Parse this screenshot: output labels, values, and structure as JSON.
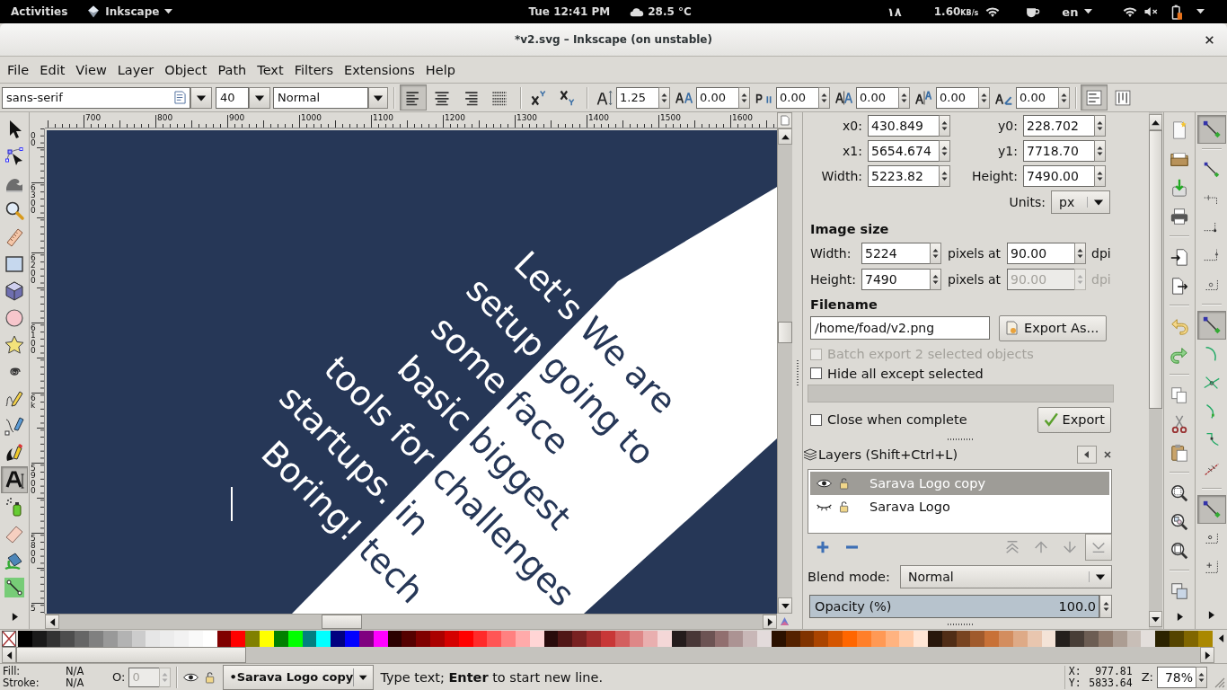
{
  "top_bar": {
    "activities": "Activities",
    "app_menu": "Inkscape",
    "clock": "Tue 12:41 PM",
    "weather": "28.5 °C",
    "indicator": "۱۸",
    "net_speed": "1.60",
    "net_unit": "KB/s",
    "language": "en"
  },
  "window": {
    "title": "*v2.svg – Inkscape (on unstable)"
  },
  "menu": [
    "File",
    "Edit",
    "View",
    "Layer",
    "Object",
    "Path",
    "Text",
    "Filters",
    "Extensions",
    "Help"
  ],
  "text_toolbar": {
    "font_family": "sans-serif",
    "font_size": "40",
    "font_style": "Normal",
    "align_buttons": [
      {
        "kind": "left",
        "selected": true
      },
      {
        "kind": "center",
        "selected": false
      },
      {
        "kind": "right",
        "selected": false
      },
      {
        "kind": "justify",
        "selected": false
      }
    ],
    "script_buttons": [
      {
        "kind": "superscript",
        "selected": false
      },
      {
        "kind": "subscript",
        "selected": false
      }
    ],
    "spacing_fields": [
      {
        "kind": "line",
        "value": "1.25"
      },
      {
        "kind": "letter",
        "value": "0.00"
      },
      {
        "kind": "word",
        "value": "0.00"
      },
      {
        "kind": "kern",
        "value": "0.00"
      },
      {
        "kind": "shift",
        "value": "0.00"
      },
      {
        "kind": "rotate",
        "value": "0.00"
      }
    ],
    "orientation_buttons": [
      {
        "kind": "horizontal",
        "selected": true
      },
      {
        "kind": "vertical",
        "selected": false
      }
    ]
  },
  "toolbox": [
    {
      "kind": "select",
      "selected": false
    },
    {
      "kind": "node",
      "selected": false
    },
    {
      "kind": "tweak",
      "selected": false
    },
    {
      "kind": "zoom",
      "selected": false
    },
    {
      "kind": "measure",
      "selected": false
    },
    {
      "kind": "rect",
      "selected": false
    },
    {
      "kind": "box3d",
      "selected": false
    },
    {
      "kind": "ellipse",
      "selected": false
    },
    {
      "kind": "star",
      "selected": false
    },
    {
      "kind": "spiral",
      "selected": false
    },
    {
      "kind": "pencil",
      "selected": false
    },
    {
      "kind": "pen",
      "selected": false
    },
    {
      "kind": "calligraphy",
      "selected": false
    },
    {
      "kind": "text",
      "selected": true
    },
    {
      "kind": "spray",
      "selected": false
    },
    {
      "kind": "eraser",
      "selected": false
    },
    {
      "kind": "bucket",
      "selected": false
    },
    {
      "kind": "connector",
      "selected": false
    }
  ],
  "rulers": {
    "horizontal": [
      "700",
      "800",
      "900",
      "1000",
      "1100",
      "1200",
      "1300",
      "1400",
      "1500",
      "1600"
    ],
    "vertical": [
      "00",
      "6300",
      "6200",
      "6100",
      "6k",
      "5900",
      "5800",
      "5"
    ]
  },
  "canvas": {
    "text_blocks": [
      {
        "kind": "right",
        "color": "#ffffff",
        "lines": [
          "Let's",
          "setup",
          "some",
          "basic",
          "tools for",
          "startups.",
          "Boring!"
        ]
      },
      {
        "kind": "left",
        "color": "#263757",
        "lines": [
          "We are",
          "going to",
          "face",
          "biggest",
          "challenges",
          "in",
          "tech"
        ]
      }
    ]
  },
  "export_panel": {
    "coords": [
      {
        "label": "x0:",
        "value": "430.849"
      },
      {
        "label": "y0:",
        "value": "228.702"
      },
      {
        "label": "x1:",
        "value": "5654.674"
      },
      {
        "label": "y1:",
        "value": "7718.70"
      },
      {
        "label": "Width:",
        "value": "5223.82"
      },
      {
        "label": "Height:",
        "value": "7490.00"
      }
    ],
    "units_label": "Units:",
    "units": "px",
    "image_size_heading": "Image size",
    "image_rows": [
      {
        "label": "Width:",
        "pixels": "5224",
        "at_label": "pixels at",
        "dpi": "90.00",
        "dpi_label": "dpi",
        "dpi_disabled": false
      },
      {
        "label": "Height:",
        "pixels": "7490",
        "at_label": "pixels at",
        "dpi": "90.00",
        "dpi_label": "dpi",
        "dpi_disabled": true
      }
    ],
    "filename_heading": "Filename",
    "filename": "/home/foad/v2.png",
    "export_as_button": "Export As...",
    "options": [
      {
        "label": "Batch export 2 selected objects",
        "checked": false,
        "disabled": true
      },
      {
        "label": "Hide all except selected",
        "checked": false,
        "disabled": false
      }
    ],
    "progress": {
      "level": 0
    },
    "close_option": {
      "label": "Close when complete",
      "checked": false
    },
    "export_button": "Export"
  },
  "layers_panel": {
    "title": "Layers (Shift+Ctrl+L)",
    "layers": [
      {
        "name": "Sarava Logo copy",
        "visible": true,
        "locked": false,
        "selected": true
      },
      {
        "name": "Sarava Logo",
        "visible": false,
        "locked": false,
        "selected": false
      }
    ],
    "blend_label": "Blend mode:",
    "blend_mode": "Normal",
    "opacity_label": "Opacity (%)",
    "opacity_value": "100.0",
    "opacity": {
      "level": 1
    }
  },
  "snap_bar": [
    [
      {
        "kind": "toggle",
        "on": true
      }
    ],
    [
      {
        "kind": "bbox",
        "on": false
      },
      {
        "kind": "bbox-edge",
        "on": false
      },
      {
        "kind": "bbox-corner",
        "on": false
      },
      {
        "kind": "bbox-midpoint",
        "on": false
      },
      {
        "kind": "bbox-center",
        "on": false
      }
    ],
    [
      {
        "kind": "nodes",
        "on": true
      },
      {
        "kind": "path",
        "on": false
      },
      {
        "kind": "intersection",
        "on": false
      },
      {
        "kind": "smooth",
        "on": false
      },
      {
        "kind": "cusp",
        "on": false
      },
      {
        "kind": "line-midpoint",
        "on": false
      }
    ],
    [
      {
        "kind": "others",
        "on": true
      },
      {
        "kind": "object-center",
        "on": false
      },
      {
        "kind": "page",
        "on": false
      }
    ]
  ],
  "palette": [
    {
      "color": "#000000"
    },
    {
      "color": "#1a1a1a"
    },
    {
      "color": "#333333"
    },
    {
      "color": "#4d4d4d"
    },
    {
      "color": "#666666"
    },
    {
      "color": "#808080"
    },
    {
      "color": "#999999"
    },
    {
      "color": "#b3b3b3"
    },
    {
      "color": "#cccccc"
    },
    {
      "color": "#e6e6e6"
    },
    {
      "color": "#ececec"
    },
    {
      "color": "#f2f2f2"
    },
    {
      "color": "#f9f9f9"
    },
    {
      "color": "#ffffff"
    },
    {
      "color": "#800000"
    },
    {
      "color": "#ff0000"
    },
    {
      "color": "#808000"
    },
    {
      "color": "#ffff00"
    },
    {
      "color": "#008000"
    },
    {
      "color": "#00ff00"
    },
    {
      "color": "#008080"
    },
    {
      "color": "#00ffff"
    },
    {
      "color": "#000080"
    },
    {
      "color": "#0000ff"
    },
    {
      "color": "#800080"
    },
    {
      "color": "#ff00ff"
    },
    {
      "color": "#2b0000"
    },
    {
      "color": "#550000"
    },
    {
      "color": "#800000"
    },
    {
      "color": "#aa0000"
    },
    {
      "color": "#d40000"
    },
    {
      "color": "#ff0000"
    },
    {
      "color": "#ff2a2a"
    },
    {
      "color": "#ff5555"
    },
    {
      "color": "#ff8080"
    },
    {
      "color": "#ffaaaa"
    },
    {
      "color": "#ffd5d5"
    },
    {
      "color": "#280b0b"
    },
    {
      "color": "#501616"
    },
    {
      "color": "#782121"
    },
    {
      "color": "#a02c2c"
    },
    {
      "color": "#c83737"
    },
    {
      "color": "#d35f5f"
    },
    {
      "color": "#de8787"
    },
    {
      "color": "#e9afaf"
    },
    {
      "color": "#f4d7d7"
    },
    {
      "color": "#241c1c"
    },
    {
      "color": "#483737"
    },
    {
      "color": "#6c5353"
    },
    {
      "color": "#916f6f"
    },
    {
      "color": "#ac9393"
    },
    {
      "color": "#c8b7b7"
    },
    {
      "color": "#e3dbdb"
    },
    {
      "color": "#2b1100"
    },
    {
      "color": "#552200"
    },
    {
      "color": "#803300"
    },
    {
      "color": "#aa4400"
    },
    {
      "color": "#d45500"
    },
    {
      "color": "#ff6600"
    },
    {
      "color": "#ff7f2a"
    },
    {
      "color": "#ff9955"
    },
    {
      "color": "#ffb380"
    },
    {
      "color": "#ffccaa"
    },
    {
      "color": "#ffe6d5"
    },
    {
      "color": "#28170b"
    },
    {
      "color": "#502d16"
    },
    {
      "color": "#784421"
    },
    {
      "color": "#a05a2c"
    },
    {
      "color": "#c87137"
    },
    {
      "color": "#d38d5f"
    },
    {
      "color": "#deaa87"
    },
    {
      "color": "#e9c6af"
    },
    {
      "color": "#f4e3d7"
    },
    {
      "color": "#241f1c"
    },
    {
      "color": "#483e37"
    },
    {
      "color": "#6c5d53"
    },
    {
      "color": "#917c6f"
    },
    {
      "color": "#ac9d93"
    },
    {
      "color": "#c8beb7"
    },
    {
      "color": "#e3dedb"
    },
    {
      "color": "#2b2200"
    },
    {
      "color": "#554400"
    },
    {
      "color": "#806600"
    },
    {
      "color": "#aa8800"
    }
  ],
  "status_bar": {
    "fill_label": "Fill:",
    "fill_value": "N/A",
    "stroke_label": "Stroke:",
    "stroke_value": "N/A",
    "opacity_label": "O:",
    "opacity_value": "0",
    "opacity_disabled": true,
    "layer_visible": true,
    "layer_locked": false,
    "current_layer": "•Sarava Logo copy",
    "message": "Type text; **Enter** to start new line.",
    "x_label": "X:",
    "x_value": "977.81",
    "y_label": "Y:",
    "y_value": "5833.64",
    "zoom_label": "Z:",
    "zoom_value": "78%"
  }
}
